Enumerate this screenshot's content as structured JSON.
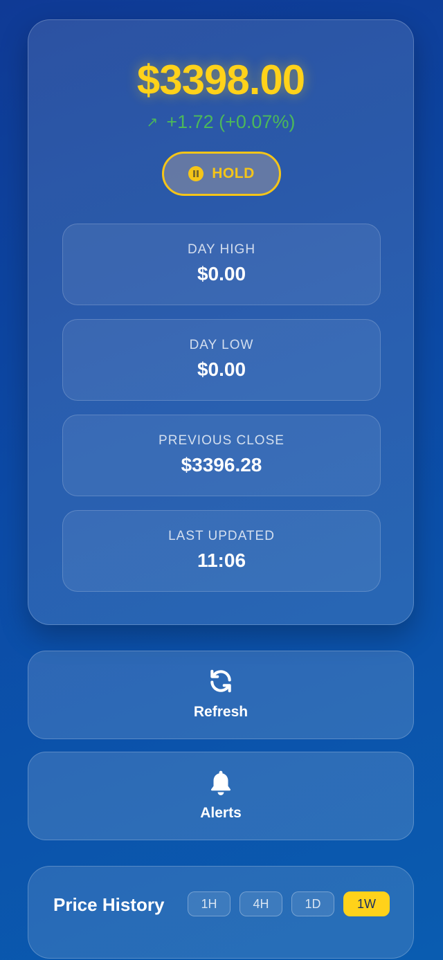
{
  "price": "$3398.00",
  "change": {
    "arrow": "↗",
    "text": "+1.72 (+0.07%)"
  },
  "signal": {
    "label": "HOLD"
  },
  "stats": [
    {
      "label": "DAY HIGH",
      "value": "$0.00"
    },
    {
      "label": "DAY LOW",
      "value": "$0.00"
    },
    {
      "label": "PREVIOUS CLOSE",
      "value": "$3396.28"
    },
    {
      "label": "LAST UPDATED",
      "value": "11:06"
    }
  ],
  "actions": {
    "refresh": "Refresh",
    "alerts": "Alerts"
  },
  "history": {
    "title": "Price History",
    "timeframes": [
      "1H",
      "4H",
      "1D",
      "1W"
    ],
    "selected": "1W"
  },
  "colors": {
    "accent": "#ffd21a",
    "positive": "#4cb85a"
  }
}
